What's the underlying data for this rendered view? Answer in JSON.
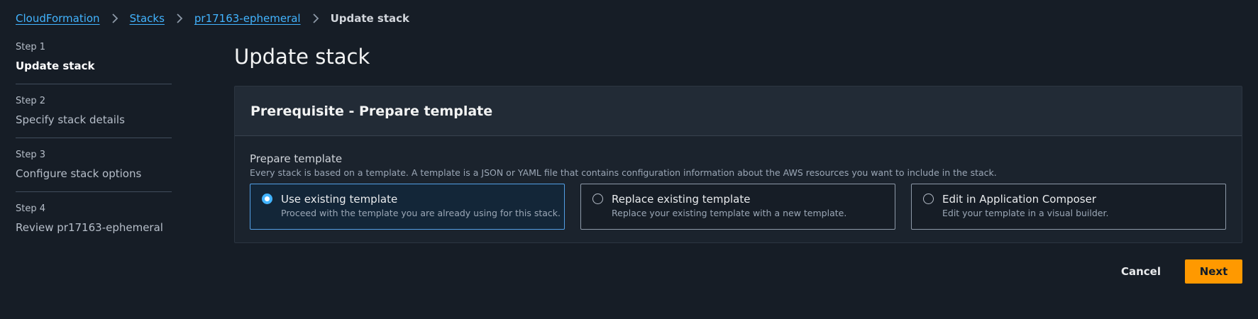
{
  "breadcrumb": {
    "items": [
      {
        "label": "CloudFormation"
      },
      {
        "label": "Stacks"
      },
      {
        "label": "pr17163-ephemeral"
      }
    ],
    "current": "Update stack"
  },
  "steps": [
    {
      "number": "Step 1",
      "title": "Update stack",
      "active": true
    },
    {
      "number": "Step 2",
      "title": "Specify stack details",
      "active": false
    },
    {
      "number": "Step 3",
      "title": "Configure stack options",
      "active": false
    },
    {
      "number": "Step 4",
      "title": "Review pr17163-ephemeral",
      "active": false
    }
  ],
  "main": {
    "title": "Update stack",
    "panel": {
      "title": "Prerequisite - Prepare template",
      "field_label": "Prepare template",
      "field_description": "Every stack is based on a template. A template is a JSON or YAML file that contains configuration information about the AWS resources you want to include in the stack.",
      "options": [
        {
          "title": "Use existing template",
          "description": "Proceed with the template you are already using for this stack.",
          "selected": true
        },
        {
          "title": "Replace existing template",
          "description": "Replace your existing template with a new template.",
          "selected": false
        },
        {
          "title": "Edit in Application Composer",
          "description": "Edit your template in a visual builder.",
          "selected": false
        }
      ]
    }
  },
  "actions": {
    "cancel_label": "Cancel",
    "next_label": "Next"
  },
  "colors": {
    "background": "#161d26",
    "link": "#42b4ff",
    "primary_button": "#ff9900",
    "selected_border": "#539fe5"
  },
  "icons": {
    "breadcrumb_separator": "chevron-right-icon",
    "radio": "radio-button-icon"
  }
}
